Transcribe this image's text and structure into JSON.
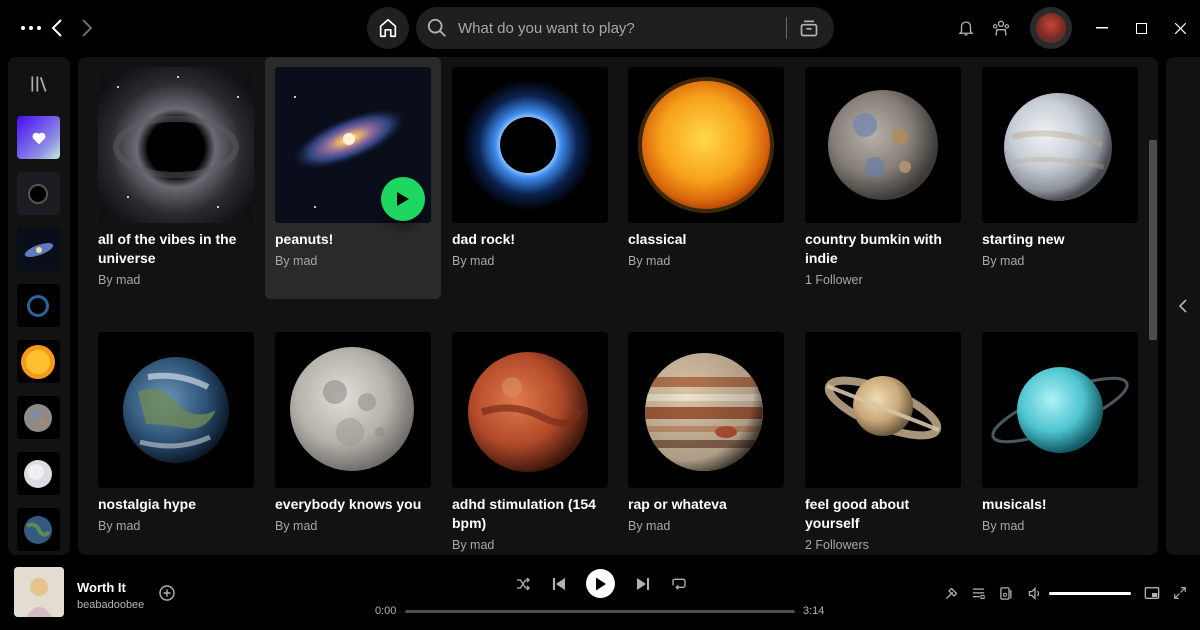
{
  "topbar": {
    "search_placeholder": "What do you want to play?"
  },
  "cards": [
    {
      "title": "all of the vibes in the universe",
      "subtitle": "By mad",
      "art": "black-hole"
    },
    {
      "title": "peanuts!",
      "subtitle": "By mad",
      "art": "galaxy"
    },
    {
      "title": "dad rock!",
      "subtitle": "By mad",
      "art": "eclipse"
    },
    {
      "title": "classical",
      "subtitle": "By mad",
      "art": "sun"
    },
    {
      "title": "country bumkin with indie",
      "subtitle": "1 Follower",
      "art": "mercury"
    },
    {
      "title": "starting new",
      "subtitle": "By mad",
      "art": "venus"
    },
    {
      "title": "nostalgia hype",
      "subtitle": "By mad",
      "art": "earth"
    },
    {
      "title": "everybody knows you",
      "subtitle": "By mad",
      "art": "moon"
    },
    {
      "title": "adhd stimulation (154 bpm)",
      "subtitle": "By mad",
      "art": "mars"
    },
    {
      "title": "rap or whateva",
      "subtitle": "By mad",
      "art": "jupiter"
    },
    {
      "title": "feel good about yourself",
      "subtitle": "2 Followers",
      "art": "saturn"
    },
    {
      "title": "musicals!",
      "subtitle": "By mad",
      "art": "uranus"
    }
  ],
  "player": {
    "track_title": "Worth It",
    "artist": "beabadoobee",
    "elapsed": "0:00",
    "duration": "3:14"
  },
  "colors": {
    "accent": "#1ed760",
    "background": "#121212",
    "hover": "#2a2a2a"
  }
}
